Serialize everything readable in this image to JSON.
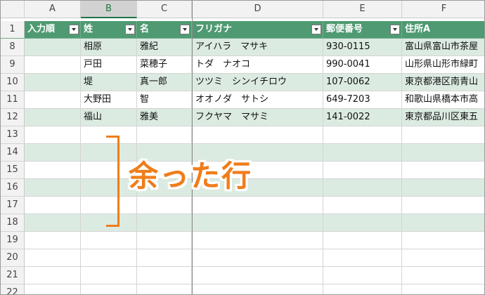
{
  "columns": [
    "A",
    "B",
    "C",
    "D",
    "E",
    "F"
  ],
  "headers": [
    "入力順",
    "姓",
    "名",
    "フリガナ",
    "郵便番号",
    "住所A"
  ],
  "rows": [
    {
      "num": "8",
      "a": "",
      "b": "相原",
      "c": "雅紀",
      "d": "アイハラ　マサキ",
      "e": "930-0115",
      "f": "富山県富山市茶屋"
    },
    {
      "num": "9",
      "a": "",
      "b": "戸田",
      "c": "菜穂子",
      "d": "トダ　ナオコ",
      "e": "990-0041",
      "f": "山形県山形市緑町"
    },
    {
      "num": "10",
      "a": "",
      "b": "堤",
      "c": "真一郎",
      "d": "ツツミ　シンイチロウ",
      "e": "107-0062",
      "f": "東京都港区南青山"
    },
    {
      "num": "11",
      "a": "",
      "b": "大野田",
      "c": "智",
      "d": "オオノダ　サトシ",
      "e": "649-7203",
      "f": "和歌山県橋本市高"
    },
    {
      "num": "12",
      "a": "",
      "b": "福山",
      "c": "雅美",
      "d": "フクヤマ　マサミ",
      "e": "141-0022",
      "f": "東京都品川区東五"
    }
  ],
  "empty_rows": [
    "13",
    "14",
    "15",
    "16",
    "17",
    "18",
    "19",
    "20",
    "21",
    "22"
  ],
  "header_row_num": "1",
  "annotation": "余った行",
  "accent_color": "#f07d1a",
  "table_header_color": "#4f9a72",
  "band_color": "#dcebe2"
}
